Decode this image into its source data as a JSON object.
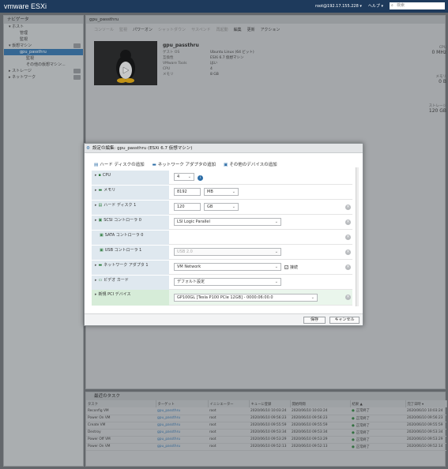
{
  "topbar": {
    "brand": "vm",
    "brand_rest": "ware ESXi",
    "user": "root@192.17.155.228 ▾",
    "help": "ヘルプ ▾",
    "search_placeholder": "検索"
  },
  "nav": {
    "title": "ナビゲータ",
    "items": [
      {
        "label": "▾ ホスト"
      },
      {
        "label": "管理"
      },
      {
        "label": "監視"
      },
      {
        "label": "▾ 仮想マシン"
      },
      {
        "label": "gpu_passthru"
      },
      {
        "label": "監視"
      },
      {
        "label": "その他の仮想マシン..."
      },
      {
        "label": "▸ ストレージ"
      },
      {
        "label": "▸ ネットワーク"
      }
    ]
  },
  "main": {
    "title": "gpu_passthru",
    "toolbar": [
      "コンソール",
      "監視",
      "パワーオン",
      "シャットダウン",
      "サスペンド",
      "再起動",
      "編集",
      "更新",
      "アクション"
    ],
    "vm_name": "gpu_passthru",
    "props": [
      {
        "k": "ゲスト OS",
        "v": "Ubuntu Linux (64 ビット)"
      },
      {
        "k": "互換性",
        "v": "ESXi 6.7 仮想マシン"
      },
      {
        "k": "VMware Tools",
        "v": "はい"
      },
      {
        "k": "CPU",
        "v": "4"
      },
      {
        "k": "メモリ",
        "v": "8 GB"
      }
    ],
    "meters": [
      {
        "label": "CPU",
        "value": "0 MHz"
      },
      {
        "label": "メモリ",
        "value": "0 B"
      },
      {
        "label": "ストレージ",
        "value": "120 GB"
      }
    ]
  },
  "modal": {
    "title": "設定の編集: gpu_passthru (ESXi 6.7 仮想マシン)",
    "add_hdd": "ハード ディスクの追加",
    "add_nic": "ネットワーク アダプタの追加",
    "add_other": "その他のデバイスの追加",
    "rows": [
      {
        "label": "CPU",
        "value": "4"
      },
      {
        "label": "メモリ",
        "value": "8192",
        "unit": "MB"
      },
      {
        "label": "ハード ディスク 1",
        "value": "120",
        "unit": "GB"
      },
      {
        "label": "SCSI コントローラ 0",
        "value": "LSI Logic Parallel"
      },
      {
        "label": "SATA コントローラ 0",
        "value": ""
      },
      {
        "label": "USB コントローラ 1",
        "value": "USB 2.0"
      },
      {
        "label": "ネットワーク アダプタ 1",
        "value": "VM Network",
        "check": "接続"
      },
      {
        "label": "ビデオ カード",
        "value": "デフォルト設定"
      },
      {
        "label": "新規 PCI デバイス",
        "value": "GP100GL [Tesla P100 PCIe 12GB] - 0000:06:00.0"
      }
    ],
    "save": "保存",
    "cancel": "キャンセル"
  },
  "tasks": {
    "title": "最近のタスク",
    "columns": [
      "タスク",
      "ターゲット",
      "イニシエーター",
      "キューに登録",
      "開始時間",
      "結果 ▲",
      "完了日時 ▾"
    ],
    "rows": [
      [
        "Reconfig VM",
        "gpu_passthru",
        "root",
        "2020/06/10 10:03:24",
        "2020/06/10 10:03:24",
        "正常終了",
        "2020/06/10 10:03:24"
      ],
      [
        "Power On VM",
        "gpu_passthru",
        "root",
        "2020/06/10 09:56:23",
        "2020/06/10 09:56:23",
        "正常終了",
        "2020/06/10 09:56:23"
      ],
      [
        "Create VM",
        "gpu_passthru",
        "root",
        "2020/06/10 09:55:59",
        "2020/06/10 09:55:59",
        "正常終了",
        "2020/06/10 09:55:59"
      ],
      [
        "Destroy",
        "gpu_passthru",
        "root",
        "2020/06/10 09:53:34",
        "2020/06/10 09:53:34",
        "正常終了",
        "2020/06/10 09:53:34"
      ],
      [
        "Power Off VM",
        "gpu_passthru",
        "root",
        "2020/06/10 09:53:29",
        "2020/06/10 09:53:29",
        "正常終了",
        "2020/06/10 09:53:29"
      ],
      [
        "Power On VM",
        "gpu_passthru",
        "root",
        "2020/06/10 09:52:13",
        "2020/06/10 09:52:13",
        "正常終了",
        "2020/06/10 09:52:14"
      ]
    ]
  }
}
